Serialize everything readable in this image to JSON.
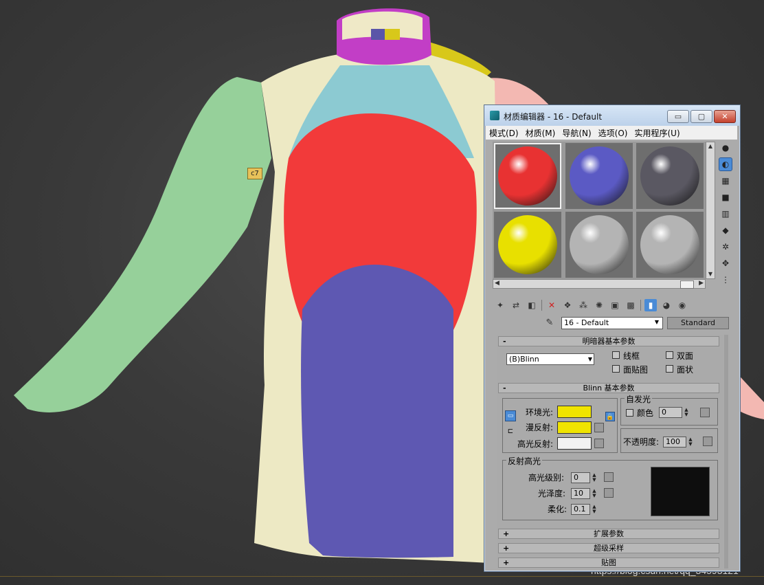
{
  "window": {
    "title": "材质编辑器 - 16 - Default",
    "min_label": "▭",
    "max_label": "▢",
    "close_label": "✕"
  },
  "menu": [
    {
      "label": "模式(D)"
    },
    {
      "label": "材质(M)"
    },
    {
      "label": "导航(N)"
    },
    {
      "label": "选项(O)"
    },
    {
      "label": "实用程序(U)"
    }
  ],
  "viewport": {
    "tag_label": "c7",
    "watermark": "https://blog.csdn.net/qq_34593121"
  },
  "sample_slots": [
    {
      "color": "#e83232",
      "selected": true
    },
    {
      "color": "#5b5ac4",
      "selected": false
    },
    {
      "color": "#5a5862",
      "selected": false
    },
    {
      "color": "#e8e000",
      "selected": false
    },
    {
      "color": "#b4b4b4",
      "selected": false
    },
    {
      "color": "#b4b4b4",
      "selected": false
    }
  ],
  "icons": {
    "side_tools": [
      "sample-type-icon",
      "backlight-icon",
      "background-icon",
      "sample-uv-tiling-icon",
      "video-color-check-icon",
      "make-preview-icon",
      "options-icon",
      "select-by-material-icon",
      "material-map-navigator-icon"
    ],
    "toolbar": [
      "get-material-icon",
      "put-to-scene-icon",
      "assign-to-selection-icon",
      "reset-map-icon",
      "make-unique-icon",
      "put-to-library-icon",
      "material-id-channel-icon",
      "show-map-in-viewport-icon",
      "show-end-result-icon",
      "go-to-parent-icon",
      "go-forward-sibling-icon"
    ]
  },
  "material": {
    "name": "16 - Default",
    "type_button": "Standard"
  },
  "shader_basic": {
    "title": "明暗器基本参数",
    "collapse": "-",
    "shader": "(B)Blinn",
    "wire": "线框",
    "two_sided": "双面",
    "face_map": "面贴图",
    "faceted": "面状"
  },
  "blinn_basic": {
    "title": "Blinn 基本参数",
    "collapse": "-",
    "ambient_label": "环境光:",
    "diffuse_label": "漫反射:",
    "specular_label": "高光反射:",
    "ambient_color": "#f0e400",
    "diffuse_color": "#f0e400",
    "specular_color": "#f2f2f2",
    "self_illum_group": "自发光",
    "self_illum_color_label": "颜色",
    "self_illum_value": "0",
    "opacity_label": "不透明度:",
    "opacity_value": "100"
  },
  "specular_highlights": {
    "group": "反射高光",
    "level_label": "高光级别:",
    "level_value": "0",
    "gloss_label": "光泽度:",
    "gloss_value": "10",
    "soften_label": "柔化:",
    "soften_value": "0.1"
  },
  "rollouts": [
    {
      "sign": "+",
      "title": "扩展参数"
    },
    {
      "sign": "+",
      "title": "超级采样"
    },
    {
      "sign": "+",
      "title": "贴图"
    }
  ]
}
